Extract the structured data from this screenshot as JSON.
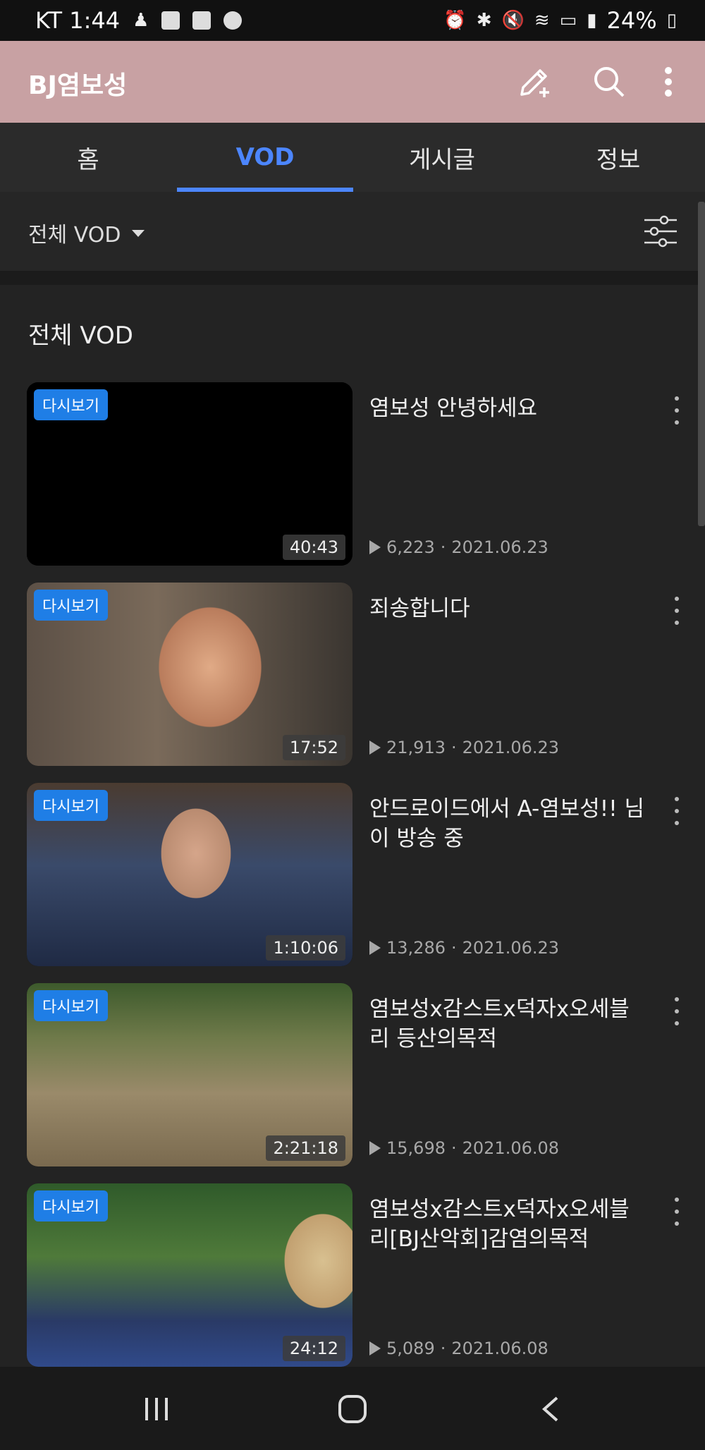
{
  "status_bar": {
    "carrier_time": "KT 1:44",
    "battery": "24%",
    "icons": [
      "app-icon",
      "notes-icon",
      "notes-icon",
      "chat-icon",
      "alarm-icon",
      "bluetooth-icon",
      "mute-icon",
      "wifi-icon",
      "hd-icon",
      "signal-icon",
      "battery-icon"
    ]
  },
  "header": {
    "title": "BJ염보성",
    "icons": [
      "edit-add-icon",
      "search-icon",
      "more-vert-icon"
    ]
  },
  "tabs": [
    {
      "label": "홈"
    },
    {
      "label": "VOD"
    },
    {
      "label": "게시글"
    },
    {
      "label": "정보"
    }
  ],
  "active_tab": "VOD",
  "filter": {
    "label": "전체 VOD"
  },
  "section": {
    "title": "전체 VOD"
  },
  "videos": [
    {
      "badge": "다시보기",
      "duration": "40:43",
      "title": "염보성 안녕하세요",
      "views": "6,223",
      "date": "2021.06.23"
    },
    {
      "badge": "다시보기",
      "duration": "17:52",
      "title": "죄송합니다",
      "views": "21,913",
      "date": "2021.06.23"
    },
    {
      "badge": "다시보기",
      "duration": "1:10:06",
      "title": "안드로이드에서 A-염보성!! 님이 방송 중",
      "views": "13,286",
      "date": "2021.06.23"
    },
    {
      "badge": "다시보기",
      "duration": "2:21:18",
      "title": "염보성x감스트x덕자x오세블리 등산의목적",
      "views": "15,698",
      "date": "2021.06.08"
    },
    {
      "badge": "다시보기",
      "duration": "24:12",
      "title": "염보성x감스트x덕자x오세블리[BJ산악회]감염의목적",
      "views": "5,089",
      "date": "2021.06.08"
    }
  ],
  "nav": [
    "recents-icon",
    "home-icon",
    "back-icon"
  ],
  "colors": {
    "header_bg": "#c8a1a3",
    "accent": "#4c86ff",
    "badge": "#1f7ee6",
    "background": "#232323"
  }
}
